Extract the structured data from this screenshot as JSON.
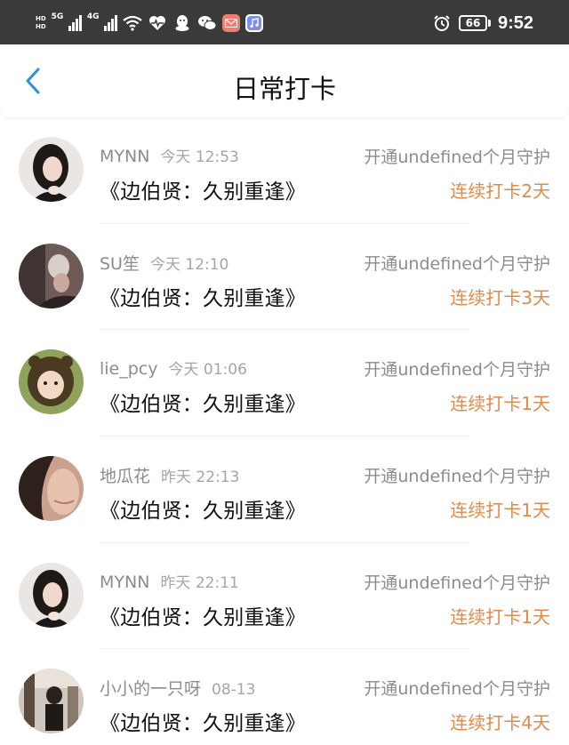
{
  "status_bar": {
    "hd_top": "HD",
    "hd_bottom": "HD",
    "net1": "5G",
    "net2": "4G",
    "icons": [
      "hd-icon",
      "signal-5g-icon",
      "signal-4g-icon",
      "wifi-icon",
      "heart-rate-icon",
      "qq-icon",
      "wechat-icon",
      "mail-app-icon",
      "music-app-icon",
      "alarm-icon",
      "battery-icon"
    ],
    "battery": "66",
    "time": "9:52",
    "colors": {
      "bar": "#3a3a3a",
      "mail_app": "#f07b6e",
      "music_app": "#7b8ef0"
    }
  },
  "header": {
    "back_icon": "chevron-left-icon",
    "title": "日常打卡",
    "accent": "#2a8fe8"
  },
  "accent_color": "#e08a4a",
  "checkins": [
    {
      "name": "MYNN",
      "time": "今天 12:53",
      "book": "《边伯贤：久别重逢》",
      "guard": "开通undefined个月守护",
      "streak": "连续打卡2天"
    },
    {
      "name": "SU笙",
      "time": "今天 12:10",
      "book": "《边伯贤：久别重逢》",
      "guard": "开通undefined个月守护",
      "streak": "连续打卡3天"
    },
    {
      "name": "lie_pcy",
      "time": "今天 01:06",
      "book": "《边伯贤：久别重逢》",
      "guard": "开通undefined个月守护",
      "streak": "连续打卡1天"
    },
    {
      "name": "地瓜花",
      "time": "昨天 22:13",
      "book": "《边伯贤：久别重逢》",
      "guard": "开通undefined个月守护",
      "streak": "连续打卡1天"
    },
    {
      "name": "MYNN",
      "time": "昨天 22:11",
      "book": "《边伯贤：久别重逢》",
      "guard": "开通undefined个月守护",
      "streak": "连续打卡1天"
    },
    {
      "name": "小小的一只呀",
      "time": "08-13",
      "book": "《边伯贤：久别重逢》",
      "guard": "开通undefined个月守护",
      "streak": "连续打卡4天"
    }
  ]
}
